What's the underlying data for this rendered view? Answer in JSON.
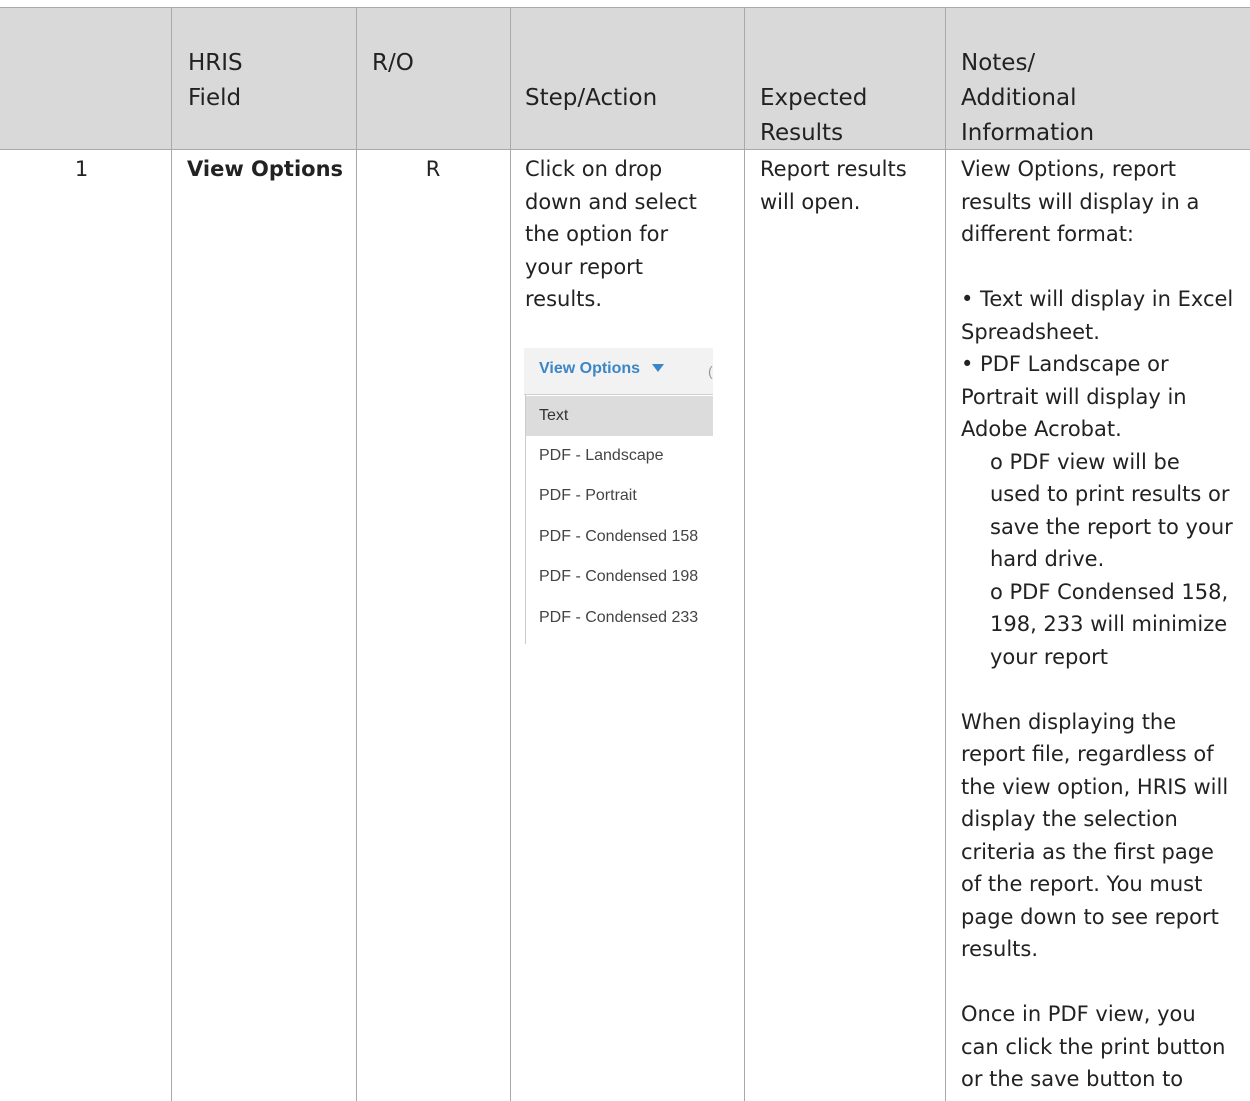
{
  "header": {
    "col1": "",
    "col2": [
      "HRIS",
      "Field"
    ],
    "col3": "R/O",
    "col4": "Step/Action",
    "col5": [
      "Expected",
      "Results"
    ],
    "col6": [
      "Notes/",
      "Additional",
      "Information"
    ]
  },
  "row": {
    "number": "1",
    "field": "View Options",
    "ro": "R",
    "step": [
      "Click on drop",
      "down and select",
      "the option for",
      "your report",
      "results."
    ],
    "expected": [
      "Report results",
      "will open."
    ],
    "notes": [
      "View Options, report",
      "results will display in a",
      "different format:",
      "",
      "• Text will display in Excel",
      "Spreadsheet.",
      "• PDF Landscape or",
      "Portrait will display in",
      "Adobe Acrobat.",
      "o PDF view will be",
      "used to print results or",
      "save the report to your",
      "hard drive.",
      "o PDF Condensed 158,",
      "198, 233 will minimize",
      "your report",
      "",
      "When displaying the",
      "report file, regardless of",
      "the view option, HRIS will",
      "display the selection",
      "criteria as the first page",
      "of the report. You must",
      "page down to see report",
      "results.",
      "",
      "Once in PDF view, you",
      "can click the print button",
      "or the save button to"
    ]
  },
  "dropdown": {
    "title": "View Options",
    "selected": "Text",
    "options": [
      "Text",
      "PDF - Landscape",
      "PDF - Portrait",
      "PDF - Condensed 158",
      "PDF - Condensed 198",
      "PDF - Condensed 233"
    ]
  }
}
